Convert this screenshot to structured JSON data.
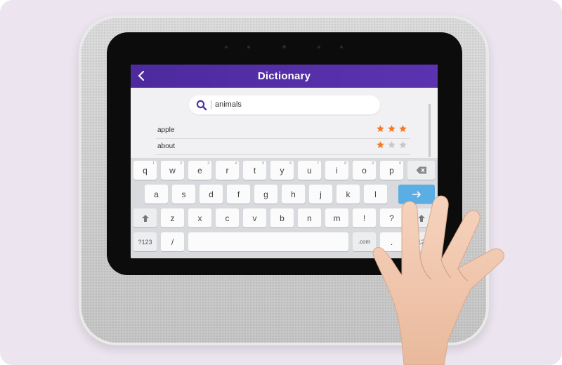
{
  "app": {
    "title": "Dictionary"
  },
  "search": {
    "value": "animals"
  },
  "words": [
    {
      "label": "apple",
      "rating": 3,
      "max": 3
    },
    {
      "label": "about",
      "rating": 1,
      "max": 3
    }
  ],
  "colors": {
    "header": "#5330a8",
    "star_filled": "#f47a2a",
    "star_empty": "#c8c8c8",
    "enter_key": "#5aaee3"
  },
  "keyboard": {
    "row1": [
      {
        "label": "q",
        "hint": "1"
      },
      {
        "label": "w",
        "hint": "2"
      },
      {
        "label": "e",
        "hint": "3"
      },
      {
        "label": "r",
        "hint": "4"
      },
      {
        "label": "t",
        "hint": "5"
      },
      {
        "label": "y",
        "hint": "6"
      },
      {
        "label": "u",
        "hint": "7"
      },
      {
        "label": "i",
        "hint": "8"
      },
      {
        "label": "o",
        "hint": "9"
      },
      {
        "label": "p",
        "hint": "0"
      }
    ],
    "row2": [
      "a",
      "s",
      "d",
      "f",
      "g",
      "h",
      "j",
      "k",
      "l"
    ],
    "row3": [
      "z",
      "x",
      "c",
      "v",
      "b",
      "n",
      "m",
      "!",
      "?"
    ],
    "symbols_label": "?123",
    "slash_label": "/",
    "dotcom_label": ".com",
    "period_label": ".",
    "symbols_label_right": "?123"
  }
}
